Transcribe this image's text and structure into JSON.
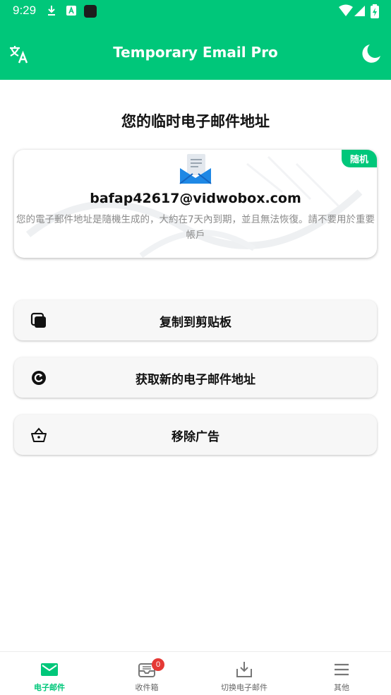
{
  "status_bar": {
    "time": "9:29",
    "icons": [
      "download-icon",
      "text-a-icon",
      "app-square-icon",
      "wifi-icon",
      "signal-icon",
      "battery-icon"
    ]
  },
  "app_bar": {
    "title": "Temporary Email Pro",
    "left_icon": "translate-icon",
    "right_icon": "moon-icon"
  },
  "heading": "您的临时电子邮件地址",
  "email_card": {
    "badge": "随机",
    "address": "bafap42617@vidwobox.com",
    "note": "您的電子郵件地址是隨機生成的，大約在7天內到期，並且無法恢復。請不要用於重要帳戶",
    "icon": "envelope-open-icon"
  },
  "actions": [
    {
      "label": "复制到剪贴板",
      "icon": "copy-icon"
    },
    {
      "label": "获取新的电子邮件地址",
      "icon": "refresh-icon"
    },
    {
      "label": "移除广告",
      "icon": "basket-icon"
    }
  ],
  "bottom_nav": {
    "items": [
      {
        "label": "电子邮件",
        "icon": "mail-icon",
        "active": true
      },
      {
        "label": "收件箱",
        "icon": "inbox-icon",
        "badge": "0"
      },
      {
        "label": "切换电子邮件",
        "icon": "download-tray-icon"
      },
      {
        "label": "其他",
        "icon": "menu-icon"
      }
    ]
  },
  "colors": {
    "accent": "#00c77a",
    "badge_red": "#e53935"
  }
}
